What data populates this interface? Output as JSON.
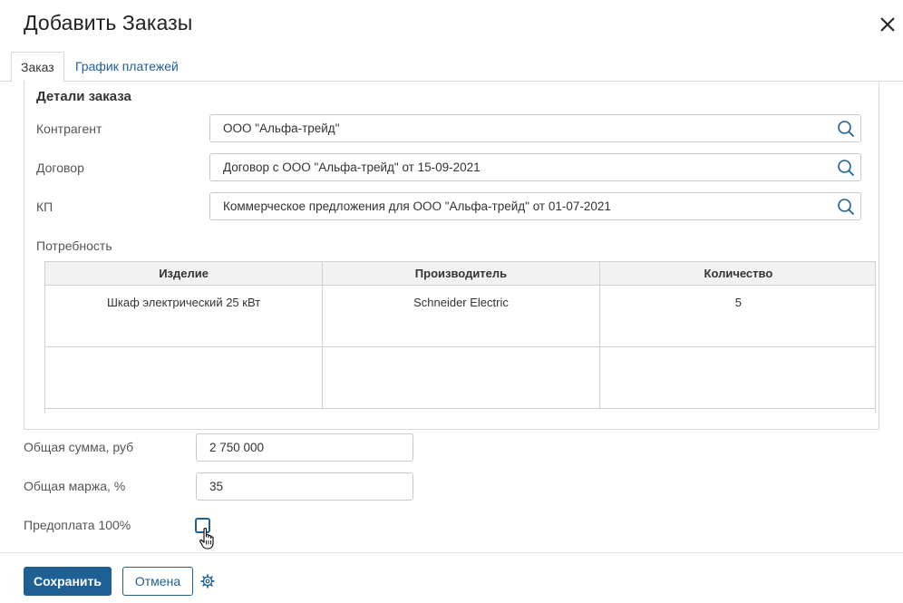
{
  "dialog": {
    "title": "Добавить Заказы"
  },
  "tabs": [
    {
      "label": "Заказ",
      "active": true
    },
    {
      "label": "График платежей",
      "active": false
    }
  ],
  "order_details": {
    "section_title": "Детали заказа",
    "counterparty": {
      "label": "Контрагент",
      "value": "ООО \"Альфа-трейд\""
    },
    "contract": {
      "label": "Договор",
      "value": "Договор с ООО \"Альфа-трейд\" от 15-09-2021"
    },
    "proposal": {
      "label": "КП",
      "value": "Коммерческое предложения для ООО \"Альфа-трейд\" от 01-07-2021"
    },
    "need": {
      "label": "Потребность",
      "columns": [
        "Изделие",
        "Производитель",
        "Количество"
      ],
      "rows": [
        [
          "Шкаф электрический 25 кВт",
          "Schneider Electric",
          "5"
        ],
        [
          "",
          "",
          ""
        ]
      ]
    }
  },
  "totals": {
    "sum": {
      "label": "Общая сумма, руб",
      "value": "2 750 000"
    },
    "margin": {
      "label": "Общая маржа, %",
      "value": "35"
    },
    "prepayment": {
      "label": "Предоплата 100%",
      "checked": false
    }
  },
  "footer": {
    "save_label": "Сохранить",
    "cancel_label": "Отмена"
  },
  "icons": {
    "close": "close-icon",
    "search": "search-icon",
    "settings": "gear-icon",
    "cursor": "hand-pointer-icon"
  },
  "colors": {
    "accent": "#1e5f94"
  }
}
